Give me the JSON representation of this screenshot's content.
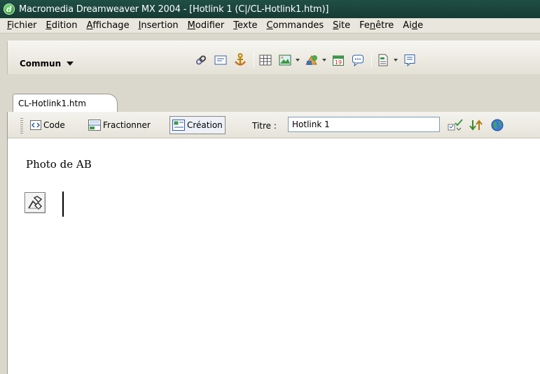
{
  "window": {
    "title": "Macromedia Dreamweaver MX 2004 - [Hotlink 1 (C|/CL-Hotlink1.htm)]",
    "icon": "dreamweaver-icon"
  },
  "menubar": {
    "items": [
      {
        "pre": "",
        "acc": "F",
        "post": "ichier"
      },
      {
        "pre": "",
        "acc": "E",
        "post": "dition"
      },
      {
        "pre": "",
        "acc": "A",
        "post": "ffichage"
      },
      {
        "pre": "",
        "acc": "I",
        "post": "nsertion"
      },
      {
        "pre": "",
        "acc": "M",
        "post": "odifier"
      },
      {
        "pre": "",
        "acc": "T",
        "post": "exte"
      },
      {
        "pre": "",
        "acc": "C",
        "post": "ommandes"
      },
      {
        "pre": "",
        "acc": "S",
        "post": "ite"
      },
      {
        "pre": "Fe",
        "acc": "n",
        "post": "être"
      },
      {
        "pre": "Ai",
        "acc": "d",
        "post": "e"
      }
    ]
  },
  "insert_bar": {
    "category": "Commun",
    "icons": [
      "hyperlink-icon",
      "email-link-icon",
      "named-anchor-icon",
      "table-icon",
      "image-icon",
      "media-icon",
      "date-icon",
      "comment-icon",
      "template-icon",
      "tag-chooser-icon"
    ]
  },
  "document": {
    "tab_label": "CL-Hotlink1.htm",
    "views": {
      "code": "Code",
      "split": "Fractionner",
      "design": "Création"
    },
    "title_label": "Titre :",
    "title_value": "Hotlink 1",
    "content_text": "Photo de AB"
  },
  "colors": {
    "titlebar": "#1f4f45",
    "chrome": "#dad7cd",
    "menubar": "#e8e6dd"
  }
}
